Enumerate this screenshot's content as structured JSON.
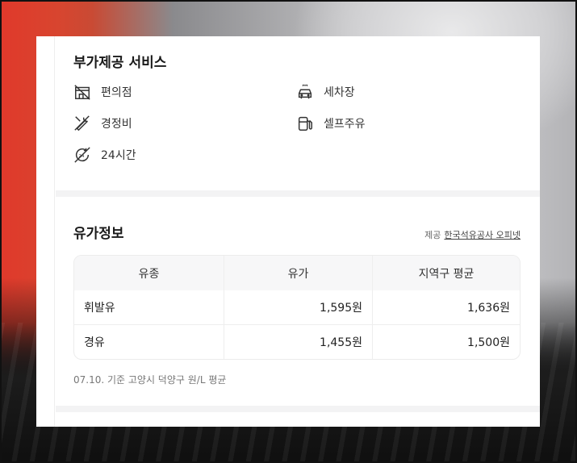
{
  "services": {
    "title": "부가제공 서비스",
    "items": [
      {
        "label": "편의점",
        "icon": "convenience-store-icon"
      },
      {
        "label": "세차장",
        "icon": "car-wash-icon"
      },
      {
        "label": "경정비",
        "icon": "repair-icon"
      },
      {
        "label": "셀프주유",
        "icon": "fuel-pump-icon"
      },
      {
        "label": "24시간",
        "icon": "24-hours-icon"
      }
    ]
  },
  "price": {
    "title": "유가정보",
    "provider_prefix": "제공",
    "provider_link": "한국석유공사 오피넷",
    "headers": [
      "유종",
      "유가",
      "지역구 평균"
    ],
    "rows": [
      {
        "fuel": "휘발유",
        "price": "1,595원",
        "avg": "1,636원"
      },
      {
        "fuel": "경유",
        "price": "1,455원",
        "avg": "1,500원"
      }
    ],
    "note": "07.10. 기준 고양시 덕양구 원/L 평균"
  }
}
